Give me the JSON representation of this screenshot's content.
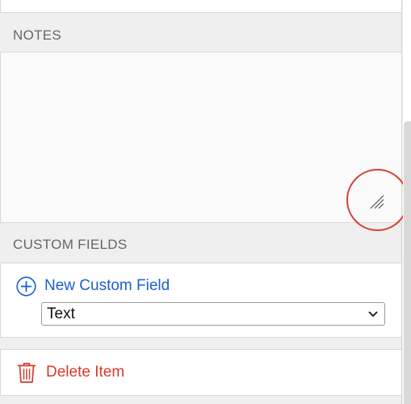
{
  "notes": {
    "header": "NOTES",
    "value": ""
  },
  "custom_fields": {
    "header": "CUSTOM FIELDS",
    "new_field_label": "New Custom Field",
    "new_field_icon": "plus-circle-icon",
    "type_select": {
      "selected": "Text",
      "icon": "chevron-down-icon"
    }
  },
  "delete": {
    "label": "Delete Item",
    "icon": "trash-icon"
  },
  "colors": {
    "link_blue": "#1a5fd0",
    "danger_red": "#d63a2c",
    "highlight_red": "#e03a2e",
    "header_text": "#666666",
    "section_bg": "#efefef"
  }
}
